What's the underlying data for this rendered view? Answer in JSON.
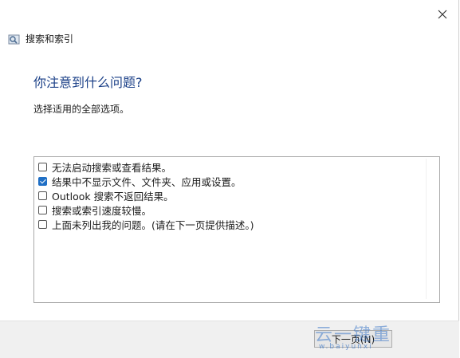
{
  "window": {
    "title": "搜索和索引",
    "close_icon": "close-icon",
    "app_icon": "search-index-icon"
  },
  "main": {
    "heading": "你注意到什么问题?",
    "subtitle": "选择适用的全部选项。",
    "options": [
      {
        "label": "无法启动搜索或查看结果。",
        "checked": false
      },
      {
        "label": "结果中不显示文件、文件夹、应用或设置。",
        "checked": true
      },
      {
        "label": "Outlook 搜索不返回结果。",
        "checked": false
      },
      {
        "label": "搜索或索引速度较慢。",
        "checked": false
      },
      {
        "label": "上面未列出我的问题。(请在下一页提供描述。)",
        "checked": false
      }
    ]
  },
  "footer": {
    "next_label": "下一页(N)"
  },
  "watermark": {
    "text": "云一键重",
    "sub": "w.baiyunxi"
  },
  "colors": {
    "heading": "#1a3f87",
    "checkbox_checked": "#1f6fc5"
  }
}
